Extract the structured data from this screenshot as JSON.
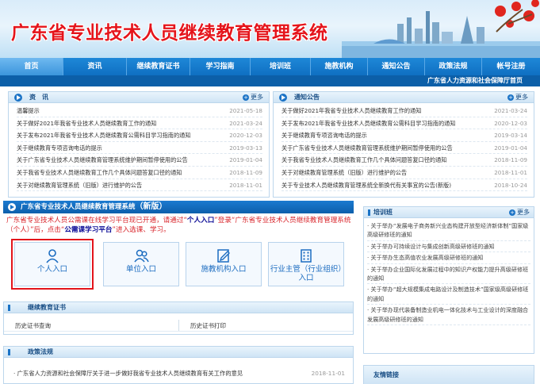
{
  "header": {
    "site_title": "广东省专业技术人员继续教育管理系统"
  },
  "nav": {
    "items": [
      "首页",
      "资讯",
      "继续教育证书",
      "学习指南",
      "培训班",
      "施教机构",
      "通知公告",
      "政策法规",
      "帐号注册"
    ],
    "active_index": 0
  },
  "subbar": {
    "department_link": "广东省人力资源和社会保障厅首页"
  },
  "news": {
    "title": "资　讯",
    "more": "更多",
    "items": [
      {
        "t": "温馨提示",
        "d": "2021-05-18"
      },
      {
        "t": "关于做好2021年我省专业技术人员继续教育工作的通知",
        "d": "2021-03-24"
      },
      {
        "t": "关于发布2021年我省专业技术人员继续教育公需科目学习指南的通知",
        "d": "2020-12-03"
      },
      {
        "t": "关于继续教育专项咨询电话的提示",
        "d": "2019-03-13"
      },
      {
        "t": "关于广东省专业技术人员继续教育管理系统维护期间暂停使用的公告",
        "d": "2019-01-04"
      },
      {
        "t": "关于我省专业技术人员继续教育工作几个具体问题答复口径的通知",
        "d": "2018-11-09"
      },
      {
        "t": "关于对继续教育管理系统（旧版）进行维护的公告",
        "d": "2018-11-01"
      }
    ]
  },
  "notice": {
    "title": "通知公告",
    "more": "更多",
    "items": [
      {
        "t": "关于做好2021年我省专业技术人员继续教育工作的通知",
        "d": "2021-03-24"
      },
      {
        "t": "关于发布2021年我省专业技术人员继续教育公需科目学习指南的通知",
        "d": "2020-12-03"
      },
      {
        "t": "关于继续教育专项咨询电话的提示",
        "d": "2019-03-14"
      },
      {
        "t": "关于广东省专业技术人员继续教育管理系统维护期间暂停使用的公告",
        "d": "2019-01-04"
      },
      {
        "t": "关于我省专业技术人员继续教育工作几个具体问题答复口径的通知",
        "d": "2018-11-09"
      },
      {
        "t": "关于对继续教育管理系统（旧版）进行维护的公告",
        "d": "2018-11-01"
      },
      {
        "t": "关于专业技术人员继续教育管理系统全新换代有关事宜的公告(新版)",
        "d": "2018-10-24"
      }
    ]
  },
  "portal": {
    "title_main": "广东省专业技术人员继续教育管理系统",
    "title_tag": "（新版）",
    "notice_text_1": "广东省专业技术人员公需课在线学习平台现已开通，请通过“",
    "notice_hl_1": "个人入口",
    "notice_text_2": "”登录“广东省专业技术人员继续教育管理系统（个人）”后，点击“",
    "notice_hl_2": "公需课学习平台",
    "notice_text_3": "”进入选课、学习。",
    "entries": [
      {
        "label": "个人入口",
        "icon": "person-icon"
      },
      {
        "label": "单位入口",
        "icon": "group-icon"
      },
      {
        "label": "施教机构入口",
        "icon": "edit-icon"
      },
      {
        "label": "行业主管（行业组织）入口",
        "icon": "building-icon"
      }
    ]
  },
  "training": {
    "title": "培训班",
    "more": "更多",
    "items": [
      "关于举办“发展电子商务新兴业态构建开放型经济新体制”国家级高级研修班的通知",
      "关于举办可持续设计与集成创新高级研修班的通知",
      "关于举办生态高值农业发展高级研修班的通知",
      "关于举办企业国际化发展过程中的知识产权能力提升高级研修班的通知",
      "关于举办“超大规模集成电路设计及制造技术”国家级高级研修班的通知",
      "关于举办现代装备制造业机电一体化技术与工业设计的深度融合发展高级研修班的通知"
    ]
  },
  "cert": {
    "title": "继续教育证书",
    "links": [
      "历史证书查询",
      "历史证书打印"
    ]
  },
  "policy": {
    "title": "政策法规",
    "items": [
      {
        "t": "广东省人力资源和社会保障厅关于进一步做好我省专业技术人员继续教育有关工作的意见",
        "d": "2018-11-01"
      }
    ]
  },
  "links": {
    "title": "友情链接"
  }
}
